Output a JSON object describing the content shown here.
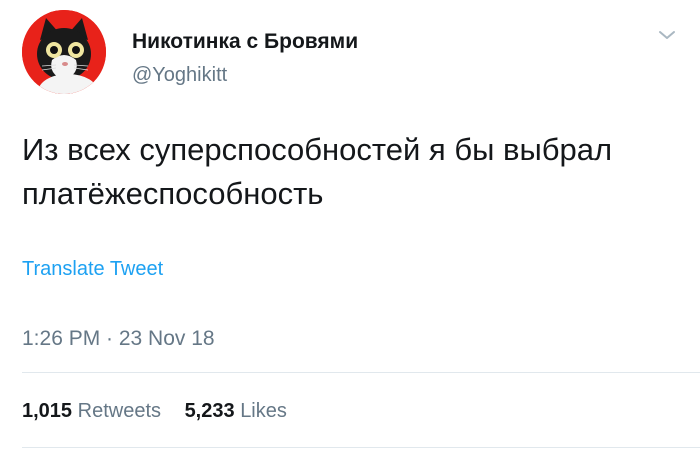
{
  "author": {
    "name": "Никотинка с Бровями",
    "handle": "@Yoghikitt"
  },
  "tweet": {
    "text_line1": "Из всех суперспособностей я бы выбрал",
    "text_line2": "платёжеспособность",
    "translate_label": "Translate Tweet",
    "timestamp": "1:26 PM · 23 Nov 18"
  },
  "stats": {
    "retweets_count": "1,015",
    "retweets_label": "Retweets",
    "likes_count": "5,233",
    "likes_label": "Likes"
  },
  "icons": {
    "avatar": "cat-avatar-icon",
    "menu": "chevron-down-icon"
  },
  "colors": {
    "link": "#1da1f2",
    "secondary_text": "#657786",
    "primary_text": "#14171a",
    "avatar_bg": "#e8221a"
  }
}
